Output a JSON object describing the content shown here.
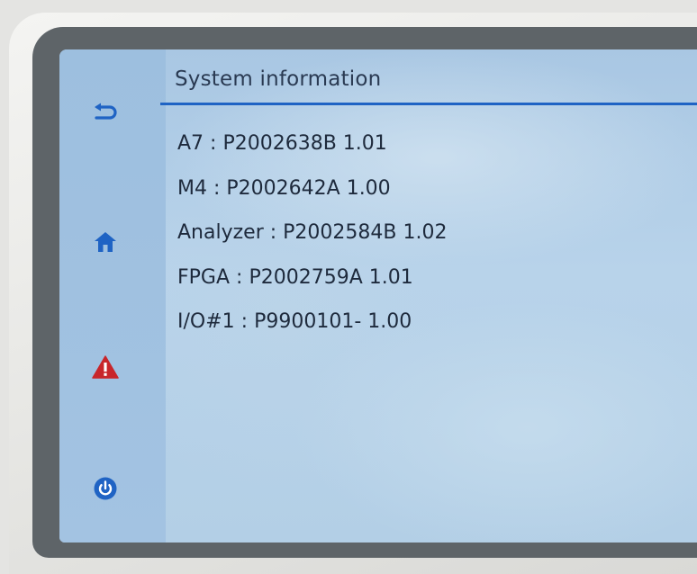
{
  "screen": {
    "title": "System information"
  },
  "sidebar": {
    "items": [
      {
        "name": "back",
        "icon": "back-arrow-icon",
        "color": "#1f63c4"
      },
      {
        "name": "home",
        "icon": "home-icon",
        "color": "#1f63c4"
      },
      {
        "name": "alarm",
        "icon": "warning-icon",
        "color": "#c8262b"
      },
      {
        "name": "power",
        "icon": "power-icon",
        "color": "#1f63c4"
      }
    ]
  },
  "info": {
    "separator": ":",
    "items": [
      {
        "label": "A7",
        "value": "P2002638B 1.01"
      },
      {
        "label": "M4",
        "value": "P2002642A 1.00"
      },
      {
        "label": "Analyzer",
        "value": "P2002584B 1.02"
      },
      {
        "label": "FPGA",
        "value": "P2002759A 1.01"
      },
      {
        "label": "I/O#1",
        "value": "P9900101- 1.00"
      }
    ]
  },
  "colors": {
    "accent": "#1f63c4",
    "warning": "#c8262b",
    "screen_bg": "#b3cfe6",
    "text": "#1e2a3c"
  }
}
